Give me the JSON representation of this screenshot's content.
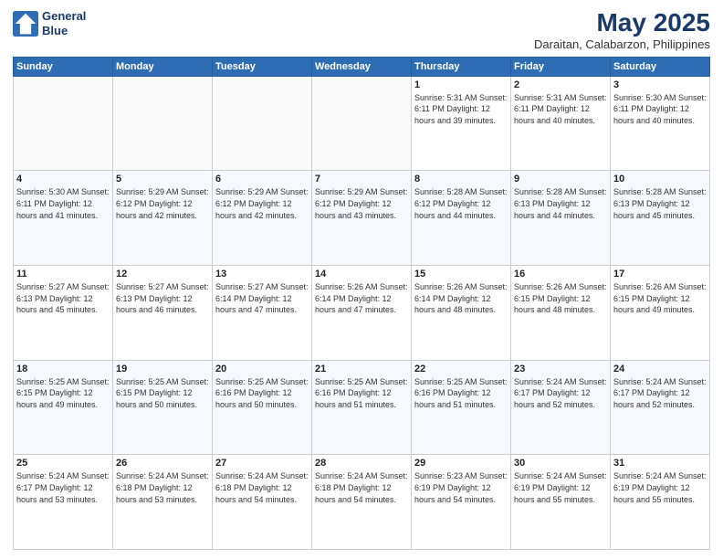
{
  "header": {
    "logo_line1": "General",
    "logo_line2": "Blue",
    "month": "May 2025",
    "location": "Daraitan, Calabarzon, Philippines"
  },
  "weekdays": [
    "Sunday",
    "Monday",
    "Tuesday",
    "Wednesday",
    "Thursday",
    "Friday",
    "Saturday"
  ],
  "weeks": [
    [
      {
        "day": "",
        "info": ""
      },
      {
        "day": "",
        "info": ""
      },
      {
        "day": "",
        "info": ""
      },
      {
        "day": "",
        "info": ""
      },
      {
        "day": "1",
        "info": "Sunrise: 5:31 AM\nSunset: 6:11 PM\nDaylight: 12 hours\nand 39 minutes."
      },
      {
        "day": "2",
        "info": "Sunrise: 5:31 AM\nSunset: 6:11 PM\nDaylight: 12 hours\nand 40 minutes."
      },
      {
        "day": "3",
        "info": "Sunrise: 5:30 AM\nSunset: 6:11 PM\nDaylight: 12 hours\nand 40 minutes."
      }
    ],
    [
      {
        "day": "4",
        "info": "Sunrise: 5:30 AM\nSunset: 6:11 PM\nDaylight: 12 hours\nand 41 minutes."
      },
      {
        "day": "5",
        "info": "Sunrise: 5:29 AM\nSunset: 6:12 PM\nDaylight: 12 hours\nand 42 minutes."
      },
      {
        "day": "6",
        "info": "Sunrise: 5:29 AM\nSunset: 6:12 PM\nDaylight: 12 hours\nand 42 minutes."
      },
      {
        "day": "7",
        "info": "Sunrise: 5:29 AM\nSunset: 6:12 PM\nDaylight: 12 hours\nand 43 minutes."
      },
      {
        "day": "8",
        "info": "Sunrise: 5:28 AM\nSunset: 6:12 PM\nDaylight: 12 hours\nand 44 minutes."
      },
      {
        "day": "9",
        "info": "Sunrise: 5:28 AM\nSunset: 6:13 PM\nDaylight: 12 hours\nand 44 minutes."
      },
      {
        "day": "10",
        "info": "Sunrise: 5:28 AM\nSunset: 6:13 PM\nDaylight: 12 hours\nand 45 minutes."
      }
    ],
    [
      {
        "day": "11",
        "info": "Sunrise: 5:27 AM\nSunset: 6:13 PM\nDaylight: 12 hours\nand 45 minutes."
      },
      {
        "day": "12",
        "info": "Sunrise: 5:27 AM\nSunset: 6:13 PM\nDaylight: 12 hours\nand 46 minutes."
      },
      {
        "day": "13",
        "info": "Sunrise: 5:27 AM\nSunset: 6:14 PM\nDaylight: 12 hours\nand 47 minutes."
      },
      {
        "day": "14",
        "info": "Sunrise: 5:26 AM\nSunset: 6:14 PM\nDaylight: 12 hours\nand 47 minutes."
      },
      {
        "day": "15",
        "info": "Sunrise: 5:26 AM\nSunset: 6:14 PM\nDaylight: 12 hours\nand 48 minutes."
      },
      {
        "day": "16",
        "info": "Sunrise: 5:26 AM\nSunset: 6:15 PM\nDaylight: 12 hours\nand 48 minutes."
      },
      {
        "day": "17",
        "info": "Sunrise: 5:26 AM\nSunset: 6:15 PM\nDaylight: 12 hours\nand 49 minutes."
      }
    ],
    [
      {
        "day": "18",
        "info": "Sunrise: 5:25 AM\nSunset: 6:15 PM\nDaylight: 12 hours\nand 49 minutes."
      },
      {
        "day": "19",
        "info": "Sunrise: 5:25 AM\nSunset: 6:15 PM\nDaylight: 12 hours\nand 50 minutes."
      },
      {
        "day": "20",
        "info": "Sunrise: 5:25 AM\nSunset: 6:16 PM\nDaylight: 12 hours\nand 50 minutes."
      },
      {
        "day": "21",
        "info": "Sunrise: 5:25 AM\nSunset: 6:16 PM\nDaylight: 12 hours\nand 51 minutes."
      },
      {
        "day": "22",
        "info": "Sunrise: 5:25 AM\nSunset: 6:16 PM\nDaylight: 12 hours\nand 51 minutes."
      },
      {
        "day": "23",
        "info": "Sunrise: 5:24 AM\nSunset: 6:17 PM\nDaylight: 12 hours\nand 52 minutes."
      },
      {
        "day": "24",
        "info": "Sunrise: 5:24 AM\nSunset: 6:17 PM\nDaylight: 12 hours\nand 52 minutes."
      }
    ],
    [
      {
        "day": "25",
        "info": "Sunrise: 5:24 AM\nSunset: 6:17 PM\nDaylight: 12 hours\nand 53 minutes."
      },
      {
        "day": "26",
        "info": "Sunrise: 5:24 AM\nSunset: 6:18 PM\nDaylight: 12 hours\nand 53 minutes."
      },
      {
        "day": "27",
        "info": "Sunrise: 5:24 AM\nSunset: 6:18 PM\nDaylight: 12 hours\nand 54 minutes."
      },
      {
        "day": "28",
        "info": "Sunrise: 5:24 AM\nSunset: 6:18 PM\nDaylight: 12 hours\nand 54 minutes."
      },
      {
        "day": "29",
        "info": "Sunrise: 5:23 AM\nSunset: 6:19 PM\nDaylight: 12 hours\nand 54 minutes."
      },
      {
        "day": "30",
        "info": "Sunrise: 5:24 AM\nSunset: 6:19 PM\nDaylight: 12 hours\nand 55 minutes."
      },
      {
        "day": "31",
        "info": "Sunrise: 5:24 AM\nSunset: 6:19 PM\nDaylight: 12 hours\nand 55 minutes."
      }
    ]
  ]
}
